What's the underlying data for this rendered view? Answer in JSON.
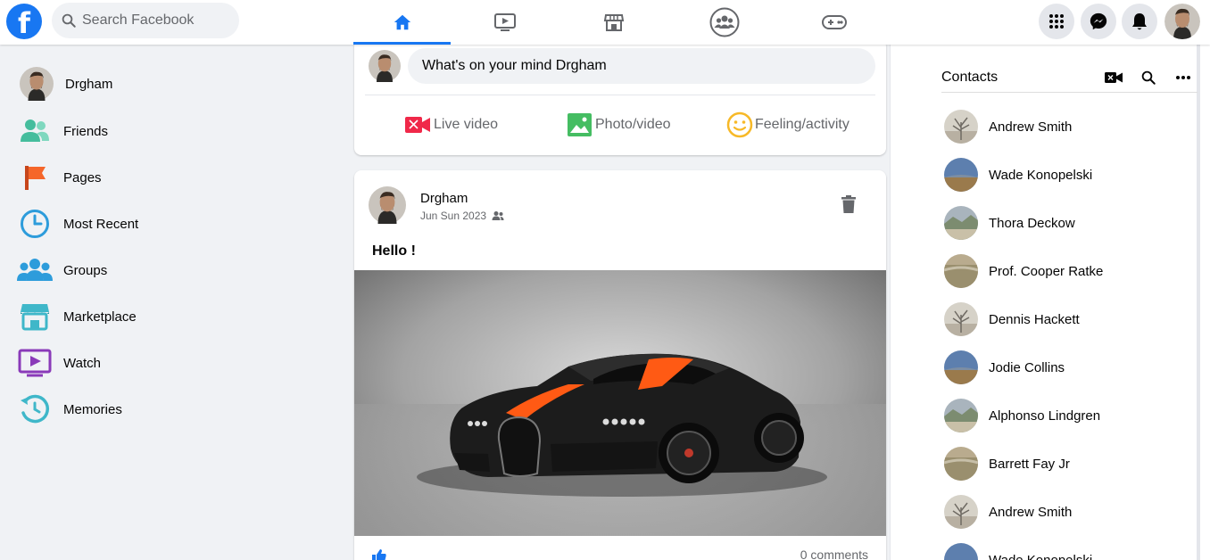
{
  "header": {
    "logo_letter": "f",
    "search_placeholder": "Search Facebook",
    "nav_tabs": [
      {
        "name": "home",
        "icon": "home-icon",
        "active": true
      },
      {
        "name": "watch",
        "icon": "video-icon",
        "active": false
      },
      {
        "name": "marketplace",
        "icon": "store-icon",
        "active": false
      },
      {
        "name": "groups",
        "icon": "groups-icon",
        "active": false
      },
      {
        "name": "gaming",
        "icon": "gamepad-icon",
        "active": false
      }
    ],
    "right_icons": [
      "menu-grid-icon",
      "messenger-icon",
      "bell-icon"
    ]
  },
  "sidebar": {
    "profile_name": "Drgham",
    "items": [
      {
        "label": "Friends",
        "icon": "friends-icon",
        "color": "#45bd9d"
      },
      {
        "label": "Pages",
        "icon": "flag-icon",
        "color": "#f5662a"
      },
      {
        "label": "Most Recent",
        "icon": "clock-icon",
        "color": "#2d9cdb"
      },
      {
        "label": "Groups",
        "icon": "groups-icon",
        "color": "#2d9cdb"
      },
      {
        "label": "Marketplace",
        "icon": "store-icon",
        "color": "#3fb7c9"
      },
      {
        "label": "Watch",
        "icon": "watch-icon",
        "color": "#8a3ab9"
      },
      {
        "label": "Memories",
        "icon": "memories-icon",
        "color": "#3fb7c9"
      }
    ]
  },
  "composer": {
    "placeholder": "What's on your mind Drgham",
    "actions": [
      {
        "label": "Live video",
        "icon": "live-video-icon",
        "color": "#f02849"
      },
      {
        "label": "Photo/video",
        "icon": "photo-icon",
        "color": "#45bd62"
      },
      {
        "label": "Feeling/activity",
        "icon": "smile-icon",
        "color": "#f7b928"
      }
    ]
  },
  "post": {
    "author": "Drgham",
    "date": "Jun Sun 2023",
    "audience_icon": "friends-audience-icon",
    "text": "Hello !",
    "image_subject": "black supercar with orange stripes",
    "comments": "0 comments"
  },
  "contacts": {
    "title": "Contacts",
    "icons": [
      "video-call-icon",
      "search-icon",
      "more-icon"
    ],
    "people": [
      "Andrew Smith",
      "Wade Konopelski",
      "Thora Deckow",
      "Prof. Cooper Ratke",
      "Dennis Hackett",
      "Jodie Collins",
      "Alphonso Lindgren",
      "Barrett Fay Jr",
      "Andrew Smith",
      "Wade Konopelski"
    ]
  },
  "colors": {
    "brand": "#1877f2",
    "background": "#f0f2f5"
  }
}
